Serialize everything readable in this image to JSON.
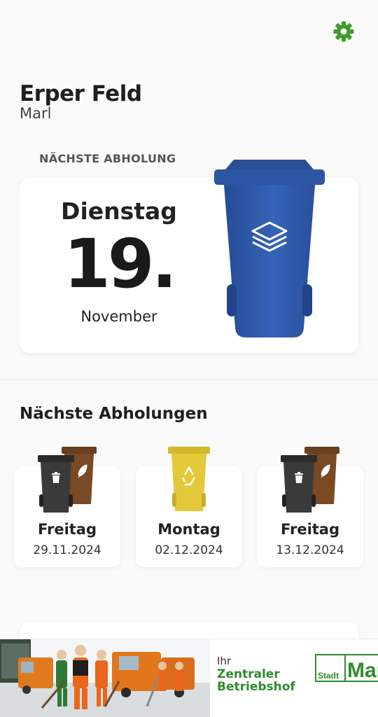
{
  "settings": {
    "icon": "gear-icon",
    "color": "#3f9b2a"
  },
  "location": {
    "name": "Erper Feld",
    "city": "Marl"
  },
  "next_pickup": {
    "label": "NÄCHSTE ABHOLUNG",
    "weekday": "Dienstag",
    "day": "19.",
    "month": "November",
    "bin": {
      "type": "blue paper bin",
      "icon": "paper-stack-icon",
      "color": "#2f5aa8"
    }
  },
  "upcoming": {
    "title": "Nächste Abholungen",
    "items": [
      {
        "weekday": "Freitag",
        "date": "29.11.2024",
        "bins": [
          "black residual bin",
          "brown organic bin"
        ]
      },
      {
        "weekday": "Montag",
        "date": "02.12.2024",
        "bins": [
          "yellow recycling bin"
        ]
      },
      {
        "weekday": "Freitag",
        "date": "13.12.2024",
        "bins": [
          "black residual bin",
          "brown organic bin"
        ]
      }
    ]
  },
  "banner": {
    "line1": "Ihr",
    "line2": "Zentraler",
    "line3": "Betriebshof",
    "logo_text_small": "Stadt",
    "logo_text_big": "Marl",
    "accent": "#2e8b2e"
  }
}
